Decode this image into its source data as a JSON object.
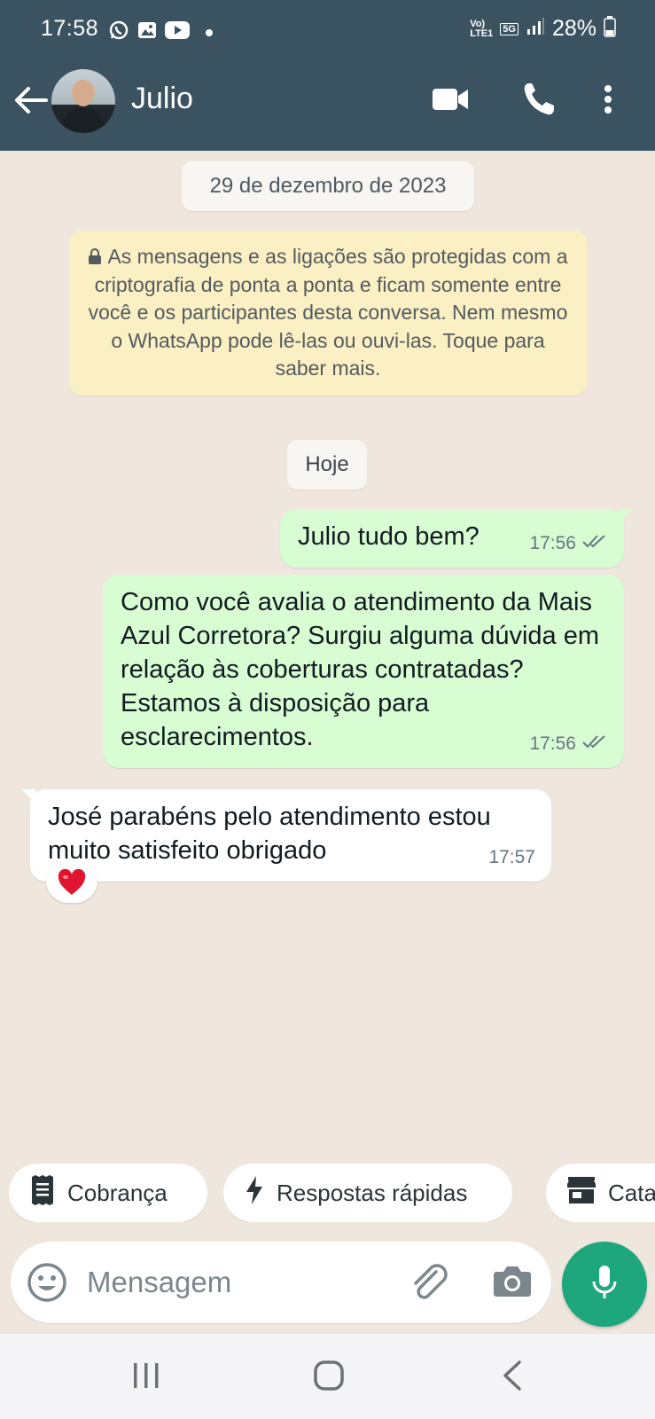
{
  "status_bar": {
    "time": "17:58",
    "network_top": "Vo)",
    "network_bottom": "LTE1",
    "network_5g": "5G",
    "battery": "28%"
  },
  "header": {
    "contact_name": "Julio"
  },
  "chat": {
    "date_chip": "29 de dezembro de 2023",
    "encryption_notice": "As mensagens e as ligações são protegidas com a criptografia de ponta a ponta e ficam somente entre você e os participantes desta conversa. Nem mesmo o WhatsApp pode lê-las ou ouvi-las. Toque para saber mais.",
    "today_chip": "Hoje",
    "messages": [
      {
        "direction": "out",
        "text": "Julio tudo bem?",
        "time": "17:56",
        "status": "delivered"
      },
      {
        "direction": "out",
        "text": "Como você avalia o atendimento da Mais Azul Corretora? Surgiu alguma dúvida em relação às coberturas contratadas? Estamos à disposição para esclarecimentos.",
        "time": "17:56",
        "status": "delivered"
      },
      {
        "direction": "in",
        "text": "José parabéns pelo atendimento estou muito satisfeito obrigado",
        "time": "17:57",
        "reaction": "❤️"
      }
    ]
  },
  "quick_chips": {
    "billing": "Cobrança",
    "quick_replies": "Respostas rápidas",
    "catalog": "Cata"
  },
  "composer": {
    "placeholder": "Mensagem"
  },
  "colors": {
    "header_bg": "#3b5361",
    "chat_bg": "#efe7de",
    "outgoing_bubble": "#d9fdd3",
    "incoming_bubble": "#ffffff",
    "notice_bg": "#fbefc4",
    "mic_button": "#1ea77d"
  }
}
